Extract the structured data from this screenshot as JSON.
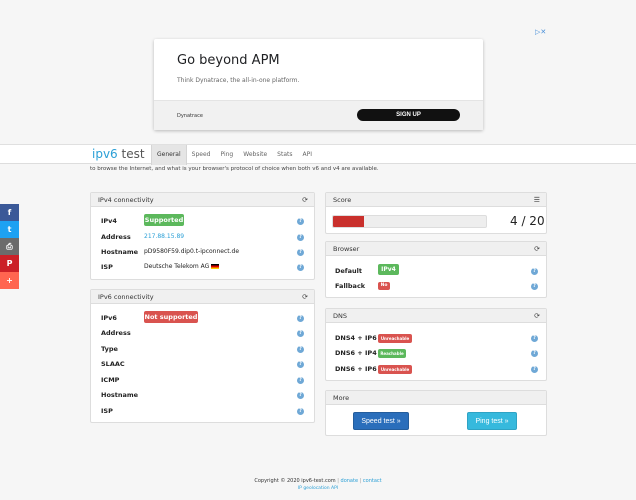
{
  "ad": {
    "title": "Go beyond APM",
    "subtitle": "Think Dynatrace, the all-in-one platform.",
    "brand": "Dynatrace",
    "cta": "SIGN UP",
    "badge": "▷✕"
  },
  "nav": {
    "logo_a": "ipv6",
    "logo_b": " test",
    "tabs": [
      "General",
      "Speed",
      "Ping",
      "Website",
      "Stats",
      "API"
    ],
    "active_tab": "General"
  },
  "intro": "to browse the Internet, and what is your browser's protocol of choice when both v6 and v4 are available.",
  "share": [
    "f",
    "t",
    "⎙",
    "P",
    "+"
  ],
  "ipv4": {
    "title": "IPv4 connectivity",
    "rows": [
      {
        "label": "IPv4",
        "value": "Supported"
      },
      {
        "label": "Address",
        "value": "217.88.15.89"
      },
      {
        "label": "Hostname",
        "value": "pD9580F59.dip0.t-ipconnect.de"
      },
      {
        "label": "ISP",
        "value": "Deutsche Telekom AG"
      }
    ]
  },
  "ipv6": {
    "title": "IPv6 connectivity",
    "rows": [
      {
        "label": "IPv6",
        "value": "Not supported"
      },
      {
        "label": "Address",
        "value": ""
      },
      {
        "label": "Type",
        "value": ""
      },
      {
        "label": "SLAAC",
        "value": ""
      },
      {
        "label": "ICMP",
        "value": ""
      },
      {
        "label": "Hostname",
        "value": ""
      },
      {
        "label": "ISP",
        "value": ""
      }
    ]
  },
  "score": {
    "title": "Score",
    "value": 4,
    "max": 20,
    "text": "4 / 20"
  },
  "browser": {
    "title": "Browser",
    "rows": [
      {
        "label": "Default",
        "value": "IPv4"
      },
      {
        "label": "Fallback",
        "value": "No"
      }
    ]
  },
  "dns": {
    "title": "DNS",
    "rows": [
      {
        "label": "DNS4 + IP6",
        "value": "Unreachable"
      },
      {
        "label": "DNS6 + IP4",
        "value": "Reachable"
      },
      {
        "label": "DNS6 + IP6",
        "value": "Unreachable"
      }
    ]
  },
  "more": {
    "title": "More",
    "speed": "Speed test »",
    "ping": "Ping test »"
  },
  "footer": {
    "copyright": "Copyright © 2020 ipv6-test.com",
    "sep": "|",
    "donate": "donate",
    "contact": "contact",
    "api": "IP geolocation API"
  },
  "colors": {
    "accent": "#2a9fd6",
    "success": "#5cb85c",
    "danger": "#d9534f"
  }
}
